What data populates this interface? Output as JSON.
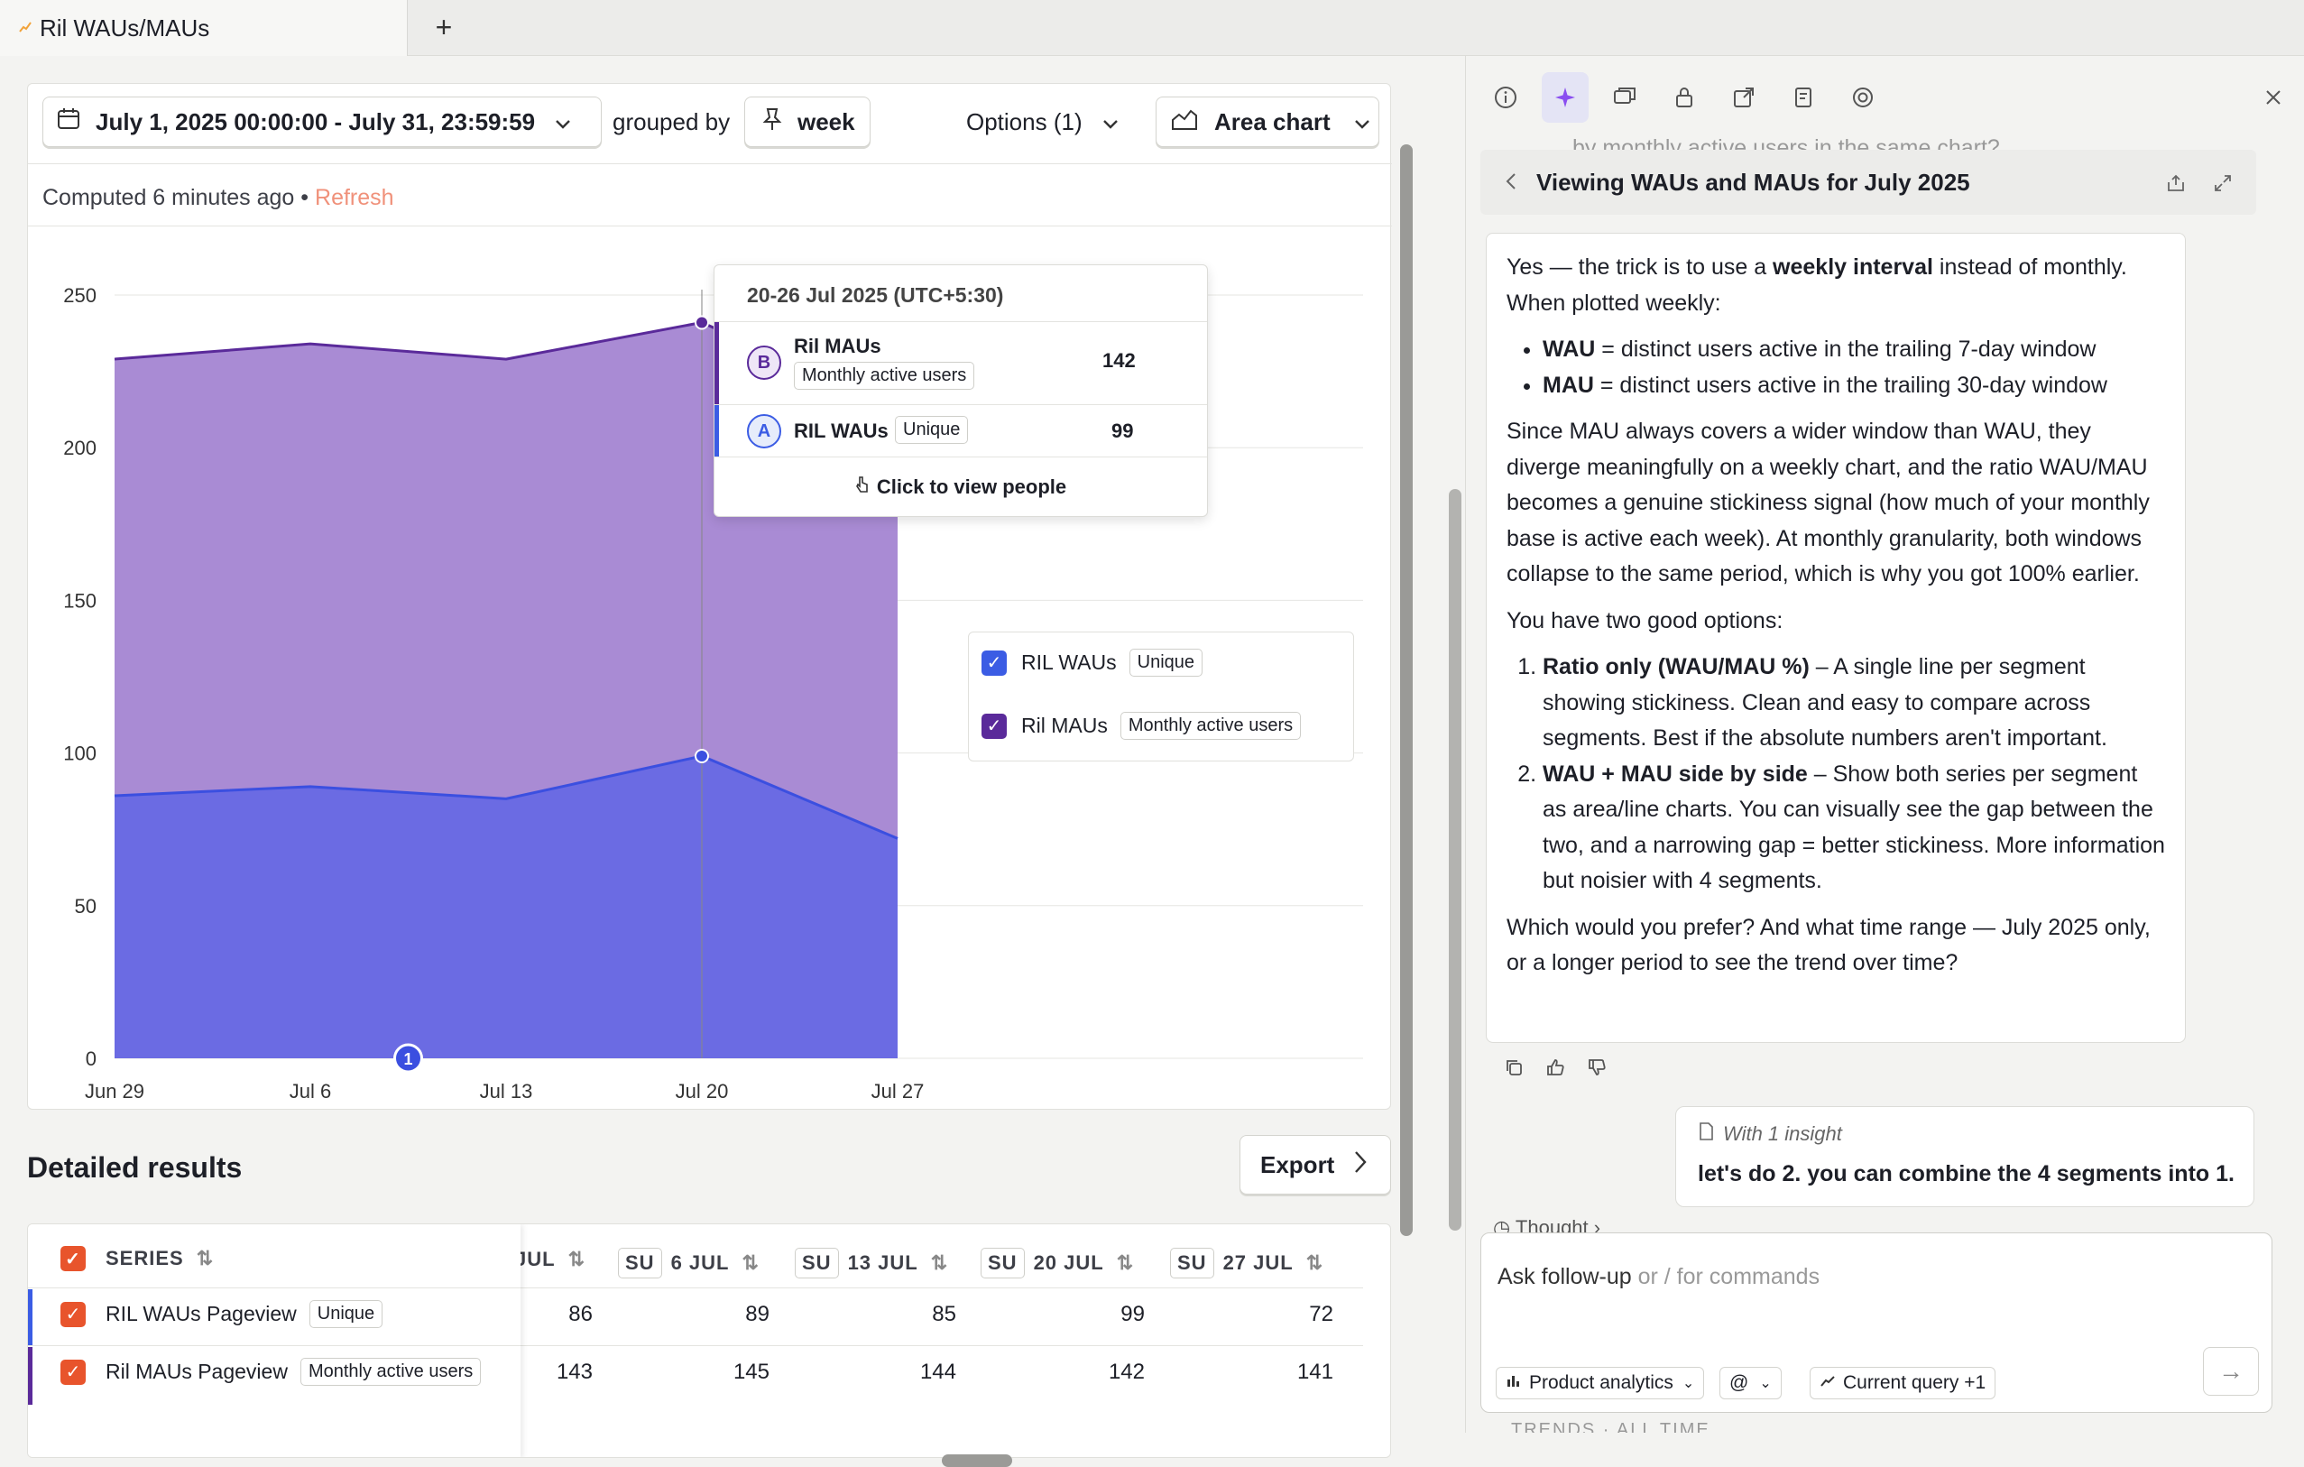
{
  "tab": {
    "title": "Ril WAUs/MAUs",
    "new_tab": "+"
  },
  "toolbar": {
    "date_range": "July 1, 2025 00:00:00 - July 31, 23:59:59",
    "grouped_by": "grouped by",
    "interval": "week",
    "options": "Options (1)",
    "chart_type": "Area chart"
  },
  "status": {
    "computed": "Computed 6 minutes ago",
    "separator": "•",
    "refresh": "Refresh"
  },
  "chart_data": {
    "type": "area",
    "x": [
      "Jun 29",
      "Jul 6",
      "Jul 13",
      "Jul 20",
      "Jul 27"
    ],
    "y_ticks": [
      "0",
      "50",
      "100",
      "150",
      "200",
      "250"
    ],
    "ylim": [
      0,
      250
    ],
    "series": [
      {
        "name": "RIL WAUs",
        "tag": "Unique",
        "color": "#6b6be3",
        "values": [
          86,
          89,
          85,
          99,
          72
        ]
      },
      {
        "name": "Ril MAUs",
        "tag": "Monthly active users",
        "color": "#a98bd4",
        "values": [
          143,
          145,
          144,
          142,
          141
        ]
      }
    ],
    "annotation_marker": "1"
  },
  "tooltip": {
    "title": "20-26 Jul 2025 (UTC+5:30)",
    "rows": [
      {
        "letter": "B",
        "name": "Ril MAUs",
        "tag": "Monthly active users",
        "value": "142"
      },
      {
        "letter": "A",
        "name": "RIL WAUs",
        "tag": "Unique",
        "value": "99"
      }
    ],
    "action": "Click to view people"
  },
  "legend": [
    {
      "name": "RIL WAUs",
      "tag": "Unique",
      "color": "#3b5ce4"
    },
    {
      "name": "Ril MAUs",
      "tag": "Monthly active users",
      "color": "#5a2a9a"
    }
  ],
  "results": {
    "title": "Detailed results",
    "export": "Export",
    "series_header": "SERIES",
    "columns": [
      {
        "dow": "",
        "date": "JUL"
      },
      {
        "dow": "SU",
        "date": "6 JUL"
      },
      {
        "dow": "SU",
        "date": "13 JUL"
      },
      {
        "dow": "SU",
        "date": "20 JUL"
      },
      {
        "dow": "SU",
        "date": "27 JUL"
      }
    ],
    "rows": [
      {
        "name": "RIL WAUs Pageview",
        "tag": "Unique",
        "values": [
          "86",
          "89",
          "85",
          "99",
          "72"
        ]
      },
      {
        "name": "Ril MAUs Pageview",
        "tag": "Monthly active users",
        "values": [
          "143",
          "145",
          "144",
          "142",
          "141"
        ]
      }
    ]
  },
  "assistant": {
    "faded_text": "by monthly active users in the same chart?",
    "viewing_title": "Viewing WAUs and MAUs for July 2025",
    "intro_a": "Yes — the trick is to use a ",
    "intro_b": "weekly interval",
    "intro_c": " instead of monthly. When plotted weekly:",
    "bullet1_b": "WAU",
    "bullet1": " = distinct users active in the trailing 7-day window",
    "bullet2_b": "MAU",
    "bullet2": " = distinct users active in the trailing 30-day window",
    "para2": "Since MAU always covers a wider window than WAU, they diverge meaningfully on a weekly chart, and the ratio WAU/MAU becomes a genuine stickiness signal (how much of your monthly base is active each week). At monthly granularity, both windows collapse to the same period, which is why you got 100% earlier.",
    "para3": "You have two good options:",
    "opt1_b": "Ratio only (WAU/MAU %)",
    "opt1": " – A single line per segment showing stickiness. Clean and easy to compare across segments. Best if the absolute numbers aren't important.",
    "opt2_b": "WAU + MAU side by side",
    "opt2": " – Show both series per segment as area/line charts. You can visually see the gap between the two, and a narrowing gap = better stickiness. More information but noisier with 4 segments.",
    "para4": "Which would you prefer? And what time range — July 2025 only, or a longer period to see the trend over time?",
    "user_insight": "With 1 insight",
    "user_message": "let's do 2. you can combine the 4 segments into 1.",
    "thought": "Thought",
    "composer_placeholder_a": "Ask follow-up",
    "composer_placeholder_b": " or / for commands",
    "pill_product": "Product analytics",
    "pill_at": "@",
    "pill_query": "Current query +1",
    "footer_faded": "TRENDS · ALL TIME"
  }
}
